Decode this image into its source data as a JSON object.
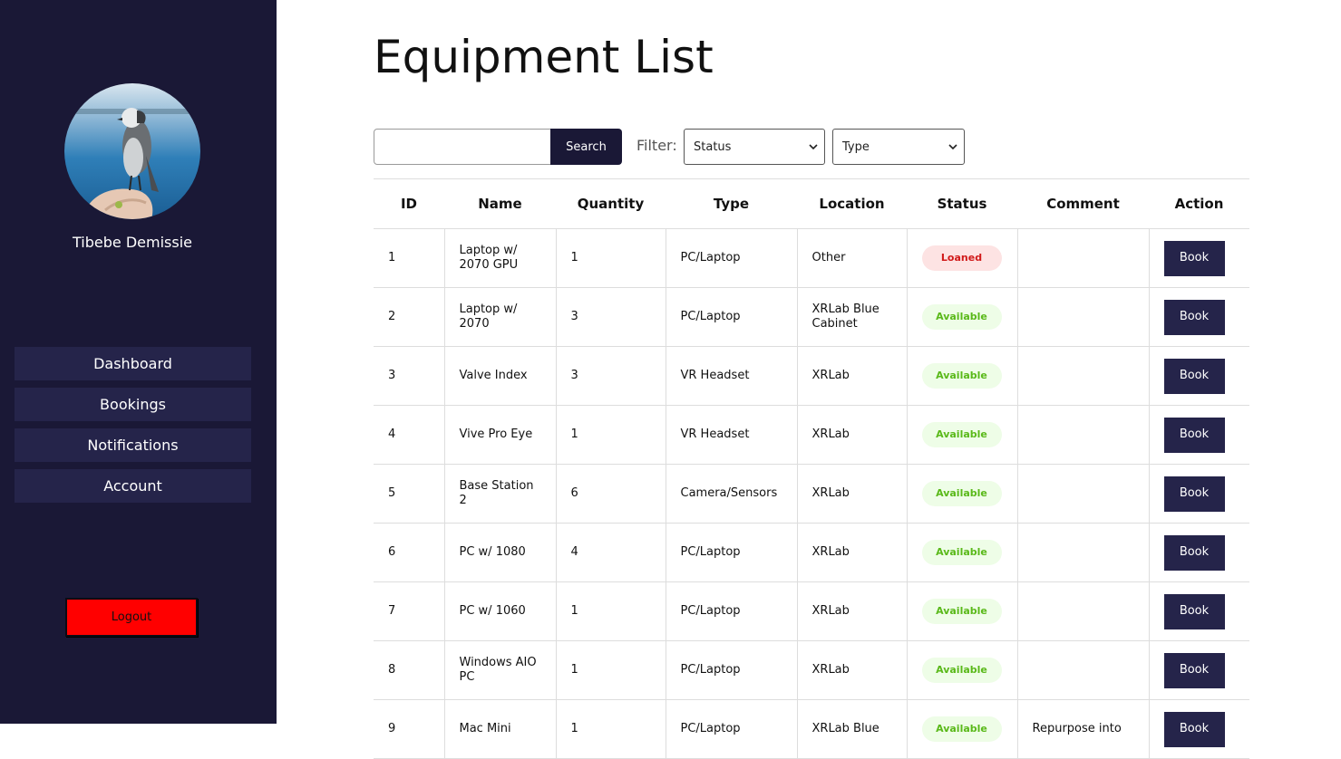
{
  "sidebar": {
    "username": "Tibebe Demissie",
    "nav": [
      "Dashboard",
      "Bookings",
      "Notifications",
      "Account"
    ],
    "logout_label": "Logout",
    "colors": {
      "background": "#1a1836",
      "nav_item": "#25244a",
      "logout": "#ff0000"
    }
  },
  "main": {
    "title": "Equipment List",
    "search": {
      "value": "",
      "placeholder": "",
      "button_label": "Search"
    },
    "filter": {
      "label": "Filter:",
      "status_selected": "Status",
      "type_selected": "Type"
    },
    "table": {
      "headers": [
        "ID",
        "Name",
        "Quantity",
        "Type",
        "Location",
        "Status",
        "Comment",
        "Action"
      ],
      "rows": [
        {
          "id": "1",
          "name": "Laptop w/ 2070 GPU",
          "quantity": "1",
          "type": "PC/Laptop",
          "location": "Other",
          "status": "Loaned",
          "comment": "",
          "action": "Book"
        },
        {
          "id": "2",
          "name": "Laptop w/ 2070",
          "quantity": "3",
          "type": "PC/Laptop",
          "location": "XRLab Blue Cabinet",
          "status": "Available",
          "comment": "",
          "action": "Book"
        },
        {
          "id": "3",
          "name": "Valve Index",
          "quantity": "3",
          "type": "VR Headset",
          "location": "XRLab",
          "status": "Available",
          "comment": "",
          "action": "Book"
        },
        {
          "id": "4",
          "name": "Vive Pro Eye",
          "quantity": "1",
          "type": "VR Headset",
          "location": "XRLab",
          "status": "Available",
          "comment": "",
          "action": "Book"
        },
        {
          "id": "5",
          "name": "Base Station 2",
          "quantity": "6",
          "type": "Camera/Sensors",
          "location": "XRLab",
          "status": "Available",
          "comment": "",
          "action": "Book"
        },
        {
          "id": "6",
          "name": "PC w/ 1080",
          "quantity": "4",
          "type": "PC/Laptop",
          "location": "XRLab",
          "status": "Available",
          "comment": "",
          "action": "Book"
        },
        {
          "id": "7",
          "name": "PC w/ 1060",
          "quantity": "1",
          "type": "PC/Laptop",
          "location": "XRLab",
          "status": "Available",
          "comment": "",
          "action": "Book"
        },
        {
          "id": "8",
          "name": "Windows AIO PC",
          "quantity": "1",
          "type": "PC/Laptop",
          "location": "XRLab",
          "status": "Available",
          "comment": "",
          "action": "Book"
        },
        {
          "id": "9",
          "name": "Mac Mini",
          "quantity": "1",
          "type": "PC/Laptop",
          "location": "XRLab Blue",
          "status": "Available",
          "comment": "Repurpose into",
          "action": "Book"
        }
      ]
    },
    "colors": {
      "loaned_bg": "#fde3e3",
      "loaned_text": "#d11a1a",
      "available_bg": "#eefde7",
      "available_text": "#5ab91a",
      "button": "#25244a"
    }
  }
}
